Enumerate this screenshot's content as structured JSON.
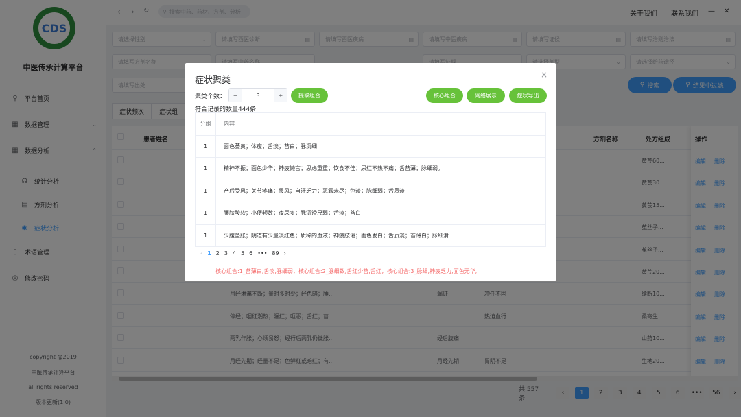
{
  "app_title": "中医传承计算平台",
  "logo_text": "CDS",
  "sidebar": {
    "items": [
      {
        "label": "平台首页",
        "icon": "location-icon"
      },
      {
        "label": "数据管理",
        "icon": "grid-icon"
      },
      {
        "label": "数据分析",
        "icon": "grid-icon"
      },
      {
        "label": "统计分析",
        "icon": "headset-icon"
      },
      {
        "label": "方剂分析",
        "icon": "calendar-icon"
      },
      {
        "label": "症状分析",
        "icon": "eye-icon"
      },
      {
        "label": "术语管理",
        "icon": "document-icon"
      },
      {
        "label": "修改密码",
        "icon": "target-icon"
      }
    ],
    "footer": [
      "copyright @2019",
      "中医传承计算平台",
      "all rights reserved",
      "版本更新(1.0)"
    ]
  },
  "topbar": {
    "search_placeholder": "搜索中药、药材、方剂、分析",
    "about": "关于我们",
    "contact": "联系我们",
    "minimize": "—",
    "close": "✕"
  },
  "filters": {
    "row1": [
      "请选择性别",
      "请填写西医诊断",
      "请填写西医疾病",
      "请填写中医疾病",
      "请填写证候",
      "请填写治则治法"
    ],
    "row2": [
      "请填写方剂名称",
      "请填写中药名称",
      "请填写证候",
      "请选择剂型",
      "请选择给药途径"
    ],
    "row3": [
      "请填写出处"
    ],
    "search_btn": "搜索",
    "result_filter_btn": "结果中过滤"
  },
  "tabs": [
    "症状频次",
    "症状组"
  ],
  "grid": {
    "headers": [
      "患者姓名",
      "方剂名称",
      "处方组成",
      "操作"
    ],
    "edit": "编辑",
    "delete": "删除",
    "rows": [
      {
        "symptom": "",
        "disease": "",
        "syndrome": "",
        "rx": "黄芪60..."
      },
      {
        "symptom": "",
        "disease": "",
        "syndrome": "",
        "rx": "黄芪30..."
      },
      {
        "symptom": "",
        "disease": "",
        "syndrome": "",
        "rx": "黄芪15..."
      },
      {
        "symptom": "",
        "disease": "",
        "syndrome": "",
        "rx": "菟丝子..."
      },
      {
        "symptom": "",
        "disease": "",
        "syndrome": "",
        "rx": "菟丝子..."
      },
      {
        "symptom": "",
        "disease": "",
        "syndrome": "",
        "rx": "黄芪20..."
      },
      {
        "symptom": "月经淋漓不断；量时多时少；经色暗；腰...",
        "disease": "漏证",
        "syndrome": "冲任不固",
        "rx": "续断10..."
      },
      {
        "symptom": "停经；咽红潮热；漏红；呕恶；舌红；苔...",
        "disease": "",
        "syndrome": "热迫血行",
        "rx": "桑寄生..."
      },
      {
        "symptom": "两乳作胀；心烦易怒；经行后两乳仍微胀...",
        "disease": "经后腹痛",
        "syndrome": "",
        "rx": "山药10..."
      },
      {
        "symptom": "月经先期；经量不足；色鲜红或暗红；有...",
        "disease": "月经先期",
        "syndrome": "胃阴不足",
        "rx": "生地20..."
      }
    ]
  },
  "pager": {
    "total": "共 557 条",
    "pages": [
      "1",
      "2",
      "3",
      "4",
      "5",
      "6",
      "•••",
      "56"
    ],
    "prev": "‹",
    "next": "›"
  },
  "modal": {
    "title": "症状聚类",
    "close": "×",
    "cluster_count_label": "聚类个数：",
    "cluster_count": "3",
    "minus": "−",
    "plus": "+",
    "extract_btn": "提取组合",
    "core_btn": "核心组合",
    "network_btn": "网络展示",
    "export_btn": "症状导出",
    "match_text": "符合记录的数量444条",
    "col_group": "分组",
    "col_content": "内容",
    "rows": [
      {
        "group": "1",
        "content": "面色萎黄；体瘦；舌淡；苔白；脉沉细"
      },
      {
        "group": "1",
        "content": "精神不振；面色少华；神疲懒言；思虑重重；饮食不佳；尿红不热不痛；舌苔薄；脉细弱。"
      },
      {
        "group": "1",
        "content": "产后受风；关节疼痛；畏风；自汗乏力；恶露未尽；色淡；脉细弱；舌质淡"
      },
      {
        "group": "1",
        "content": "腰膝酸软；小便频数；夜尿多；脉沉滑尺弱；舌淡；苔白"
      },
      {
        "group": "1",
        "content": "少腹坠胀；阴道有少量淡红色；质稀的血液；神疲肢倦；面色发白；舌质淡；苔薄白；脉细滑"
      }
    ],
    "pager": [
      "1",
      "2",
      "3",
      "4",
      "5",
      "6",
      "•••",
      "89"
    ],
    "prev": "‹",
    "next": "›",
    "core_text": "核心组合:1_苔薄白,舌淡,脉细弱，核心组合:2_脉细数,舌红少苔,舌红，核心组合:3_脉细,神疲乏力,面色无华,"
  }
}
